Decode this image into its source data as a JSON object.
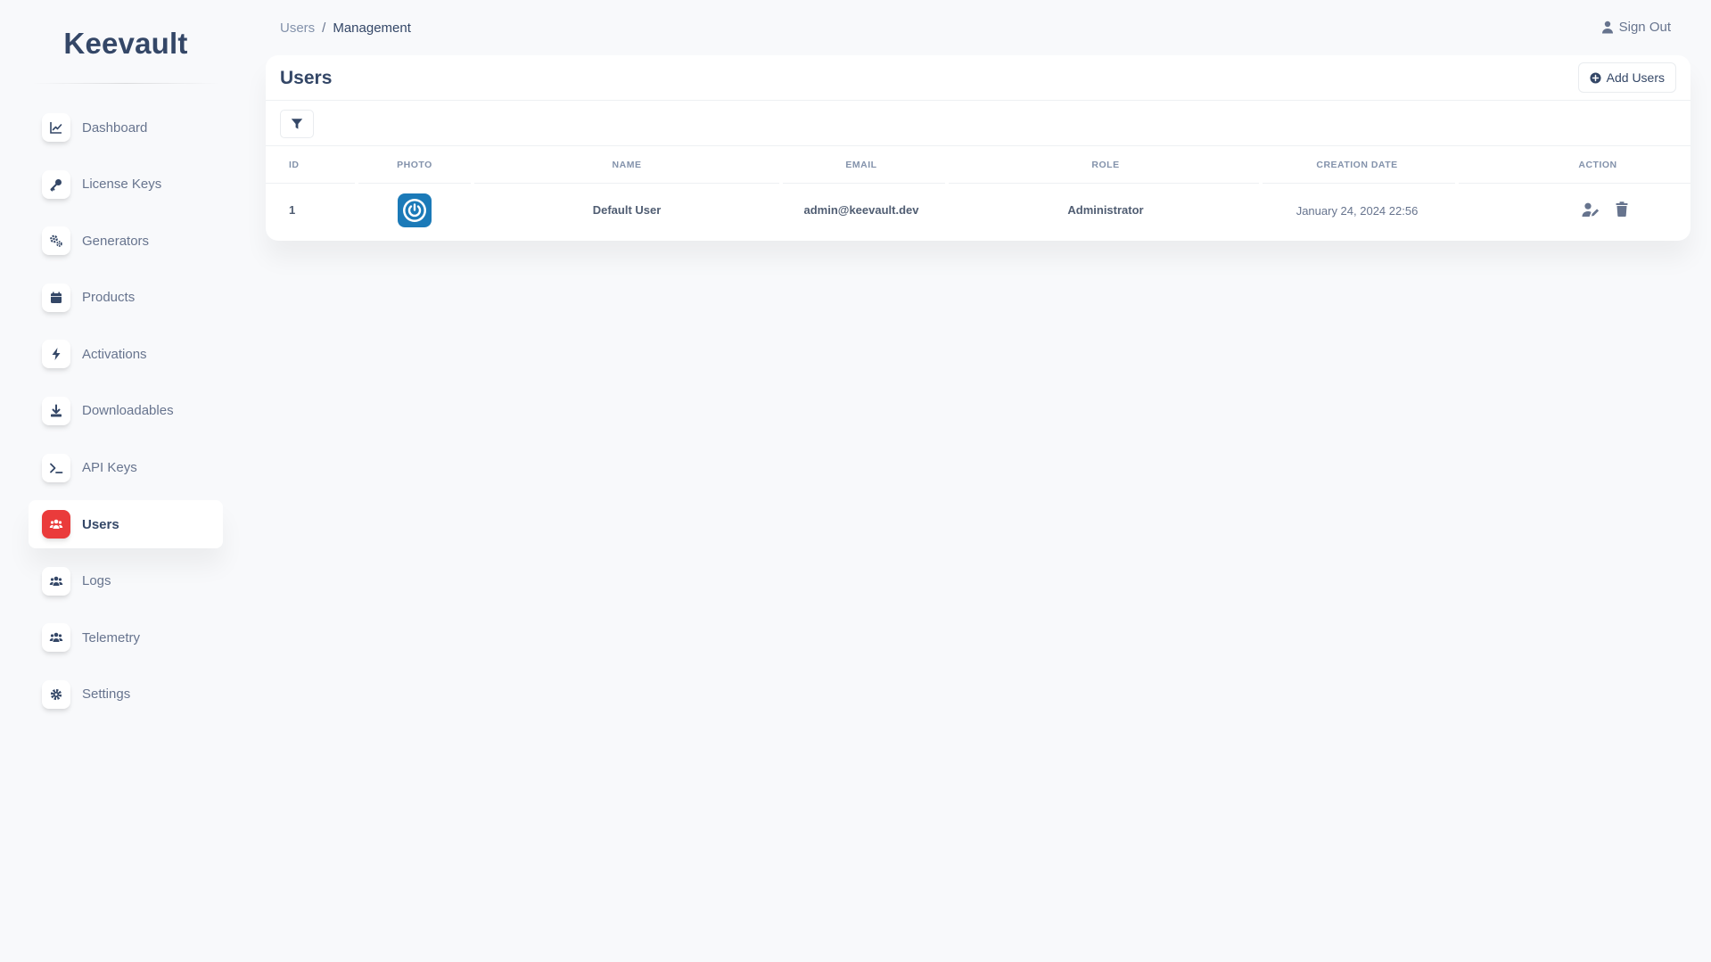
{
  "app": {
    "brand": "Keevault"
  },
  "colors": {
    "accent": "#ea3b3b",
    "text": "#344767",
    "muted": "#67748e",
    "photo_bg": "#1b7ab8"
  },
  "sidebar": {
    "items": [
      {
        "label": "Dashboard",
        "icon": "chart-line-icon",
        "active": false
      },
      {
        "label": "License Keys",
        "icon": "key-icon",
        "active": false
      },
      {
        "label": "Generators",
        "icon": "gears-icon",
        "active": false
      },
      {
        "label": "Products",
        "icon": "calendar-icon",
        "active": false
      },
      {
        "label": "Activations",
        "icon": "bolt-icon",
        "active": false
      },
      {
        "label": "Downloadables",
        "icon": "download-icon",
        "active": false
      },
      {
        "label": "API Keys",
        "icon": "terminal-icon",
        "active": false
      },
      {
        "label": "Users",
        "icon": "users-icon",
        "active": true
      },
      {
        "label": "Logs",
        "icon": "users-icon",
        "active": false
      },
      {
        "label": "Telemetry",
        "icon": "users-icon",
        "active": false
      },
      {
        "label": "Settings",
        "icon": "gear-icon",
        "active": false
      }
    ]
  },
  "header": {
    "breadcrumb": {
      "parent": "Users",
      "separator": "/",
      "current": "Management"
    },
    "signout_label": "Sign Out"
  },
  "card": {
    "title": "Users",
    "add_button_label": "Add Users"
  },
  "table": {
    "columns": [
      "ID",
      "PHOTO",
      "NAME",
      "EMAIL",
      "ROLE",
      "CREATION DATE",
      "ACTION"
    ],
    "rows": [
      {
        "id": "1",
        "photo_icon": "power-icon",
        "name": "Default User",
        "email": "admin@keevault.dev",
        "role": "Administrator",
        "created": "January 24, 2024 22:56"
      }
    ]
  }
}
